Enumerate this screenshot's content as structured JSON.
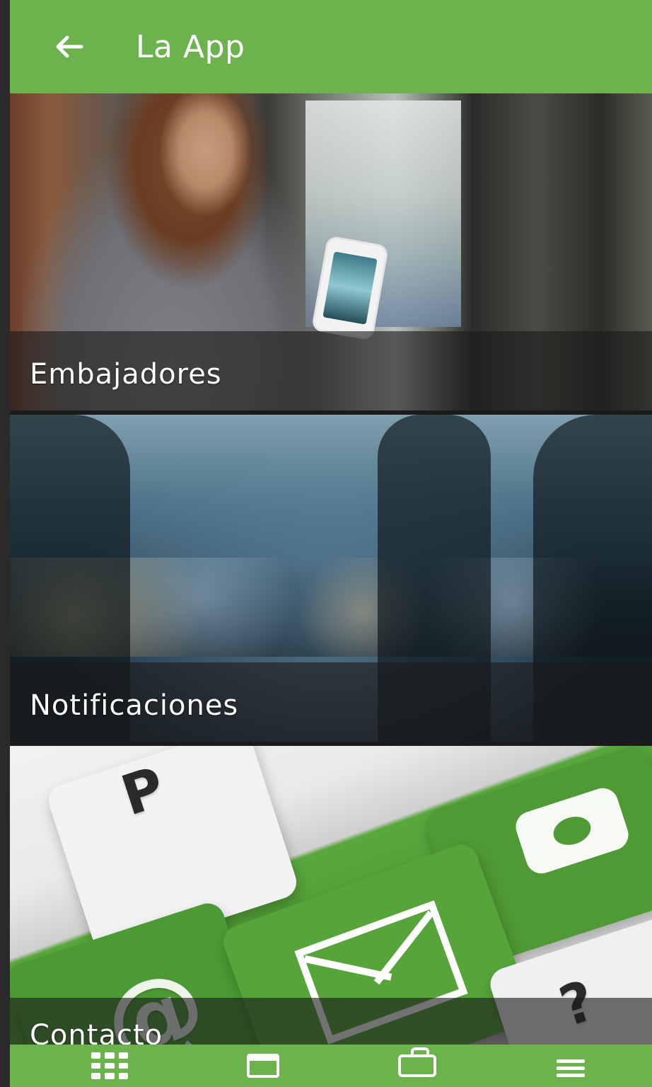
{
  "app_bar": {
    "title": "La App",
    "back_icon": "arrow-left-icon",
    "background_color": "#6cb34e"
  },
  "tiles": [
    {
      "label": "Embajadores"
    },
    {
      "label": "Notificaciones"
    },
    {
      "label": "Contacto"
    }
  ],
  "bottom_nav": {
    "background_color": "#6cb34e",
    "items": [
      {
        "icon": "grid-icon"
      },
      {
        "icon": "calendar-icon"
      },
      {
        "icon": "briefcase-icon"
      },
      {
        "icon": "menu-icon"
      }
    ]
  }
}
